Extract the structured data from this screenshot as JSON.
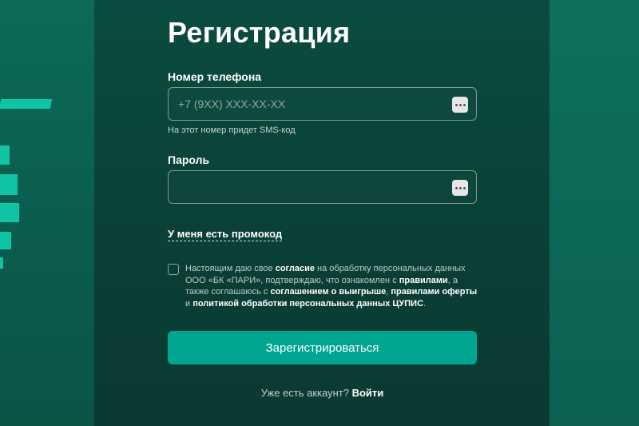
{
  "page": {
    "title": "Регистрация"
  },
  "phone": {
    "label": "Номер телефона",
    "placeholder": "+7 (9XX) XXX-XX-XX",
    "value": "",
    "hint": "На этот номер придет SMS-код",
    "icon": "password-manager-icon"
  },
  "password": {
    "label": "Пароль",
    "placeholder": "",
    "value": "",
    "icon": "password-manager-icon"
  },
  "promo": {
    "link_text": "У меня есть промокод"
  },
  "consent": {
    "checked": false,
    "part1": "Настоящим даю свое ",
    "link1": "согласие",
    "part2": " на обработку персональных данных ООО «БК «ПАРИ», подтверждаю, что ознакомлен с ",
    "link2": "правилами",
    "part3": ", а также соглашаюсь с ",
    "link3": "соглашением о выигрыше",
    "part4": ", ",
    "link4": "правилами оферты",
    "part5": " и ",
    "link5": "политикой обработки персональных данных ЦУПИС",
    "part6": "."
  },
  "actions": {
    "register_label": "Зарегистрироваться",
    "have_account_text": "Уже есть аккаунт? ",
    "login_label": "Войти"
  },
  "colors": {
    "accent": "#00a68f",
    "stripe": "#0fc3a4",
    "panel": "#0b4b40"
  }
}
